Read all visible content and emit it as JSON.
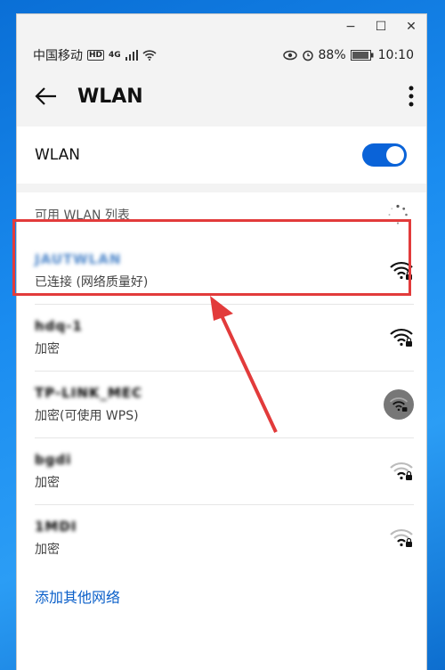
{
  "window": {
    "minimize": "−",
    "maximize": "☐",
    "close": "✕"
  },
  "statusbar": {
    "carrier": "中国移动",
    "hd": "HD",
    "net_type": "4G",
    "battery": "88%",
    "time": "10:10"
  },
  "appbar": {
    "title": "WLAN"
  },
  "wlan_toggle": {
    "label": "WLAN",
    "on": true
  },
  "list": {
    "header": "可用 WLAN 列表",
    "networks": [
      {
        "name": "JAUTWLAN",
        "status": "已连接 (网络质量好)",
        "signal": "strong",
        "locked": true
      },
      {
        "name": "hdq-1",
        "status": "加密",
        "signal": "strong",
        "locked": true
      },
      {
        "name": "TP-LINK_MEC",
        "status": "加密(可使用 WPS)",
        "signal": "medium",
        "locked": true
      },
      {
        "name": "bgdi",
        "status": "加密",
        "signal": "weak",
        "locked": true
      },
      {
        "name": "1MDI",
        "status": "加密",
        "signal": "weak",
        "locked": true
      }
    ],
    "add_network": "添加其他网络"
  },
  "colors": {
    "accent": "#0a63d8",
    "highlight": "#e23b3b"
  }
}
